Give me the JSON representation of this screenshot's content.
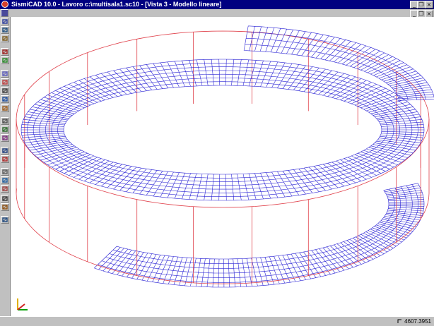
{
  "window": {
    "title": "SismiCAD 10.0 - Lavoro c:\\multisala1.sc10 - [Vista 3 - Modello lineare]",
    "min_glyph": "_",
    "restore_glyph": "❐",
    "close_glyph": "×"
  },
  "toolbar": {
    "icons": [
      "grid-icon",
      "new-icon",
      "layer-icon",
      "tools-icon",
      "pen-icon",
      "palette-icon",
      "run-icon",
      "binoculars-icon",
      "zoom-icon",
      "rotate-icon",
      "measure-icon",
      "node-icon",
      "stack-icon",
      "frame-icon",
      "wall-icon",
      "shell-icon",
      "box-icon",
      "close-mesh-icon",
      "window-icon",
      "spring-icon",
      "book-icon"
    ]
  },
  "viewport": {
    "mesh_color": "#2a23d4",
    "frame_color": "#e0404a",
    "axis_icon": "xyz-axis-icon"
  },
  "status": {
    "coordinates": "4607.3951"
  }
}
